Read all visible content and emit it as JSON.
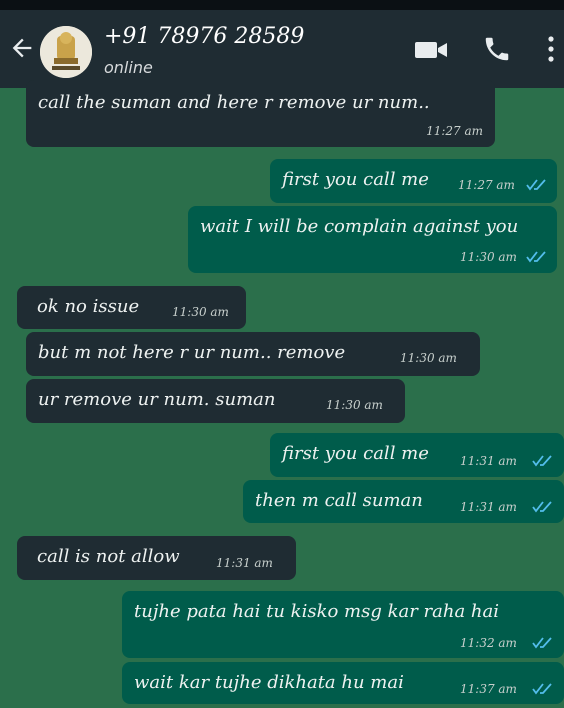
{
  "header": {
    "contact_name": "+91 78976 28589",
    "contact_status": "online",
    "icons": [
      "back-arrow-icon",
      "avatar",
      "video-call-icon",
      "voice-call-icon",
      "more-options-icon"
    ]
  },
  "messages": [
    {
      "side": "in",
      "text": "call the suman and here r remove ur num..",
      "time": "11:27 am"
    },
    {
      "side": "out",
      "text": "first you call me",
      "time": "11:27 am",
      "read": true
    },
    {
      "side": "out",
      "text": "wait I will be complain against you",
      "time": "11:30 am",
      "read": true
    },
    {
      "side": "in",
      "text": "ok no issue",
      "time": "11:30 am"
    },
    {
      "side": "in",
      "text": "but m not here r ur num.. remove",
      "time": "11:30 am"
    },
    {
      "side": "in",
      "text": "ur remove ur num. suman",
      "time": "11:30 am"
    },
    {
      "side": "out",
      "text": "first you call me",
      "time": "11:31 am",
      "read": true
    },
    {
      "side": "out",
      "text": "then m call suman",
      "time": "11:31 am",
      "read": true
    },
    {
      "side": "in",
      "text": "call is not allow",
      "time": "11:31 am"
    },
    {
      "side": "out",
      "text": "tujhe pata hai tu kisko msg kar raha hai",
      "time": "11:32 am",
      "read": true
    },
    {
      "side": "out",
      "text": "wait kar tujhe dikhata hu mai",
      "time": "11:37 am",
      "read": true
    }
  ],
  "colors": {
    "chat_bg": "#2b6f4b",
    "incoming": "#1f2c33",
    "outgoing": "#005c4b",
    "read_ticks": "#53bdeb"
  }
}
